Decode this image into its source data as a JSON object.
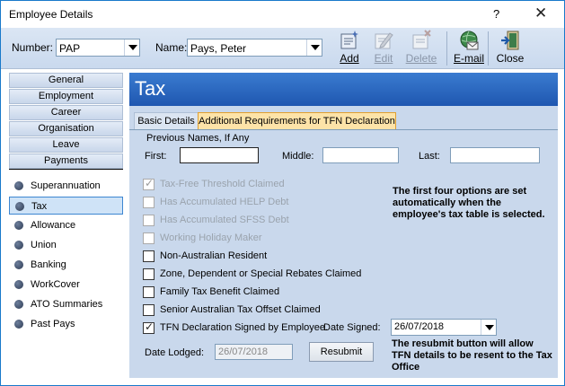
{
  "window": {
    "title": "Employee Details",
    "help_label": "?",
    "close_label": "✕"
  },
  "toolbar": {
    "number_label": "Number:",
    "number_value": "PAP",
    "name_label": "Name:",
    "name_value": "Pays, Peter",
    "buttons": [
      {
        "label": "Add",
        "enabled": true
      },
      {
        "label": "Edit",
        "enabled": false
      },
      {
        "label": "Delete",
        "enabled": false
      },
      {
        "label": "E-mail",
        "enabled": true
      },
      {
        "label": "Close",
        "enabled": true
      }
    ]
  },
  "nav": {
    "groups": [
      "General",
      "Employment",
      "Career",
      "Organisation",
      "Leave",
      "Payments"
    ],
    "items": [
      "Superannuation",
      "Tax",
      "Allowance",
      "Union",
      "Banking",
      "WorkCover",
      "ATO Summaries",
      "Past Pays"
    ],
    "selected": "Tax"
  },
  "panel": {
    "title": "Tax",
    "tabs": [
      {
        "label": "Basic Details",
        "active": false
      },
      {
        "label": "Additional Requirements for TFN Declaration",
        "active": true
      }
    ],
    "previous_names_label": "Previous Names, If Any",
    "first_label": "First:",
    "middle_label": "Middle:",
    "last_label": "Last:",
    "first_value": "",
    "middle_value": "",
    "last_value": "",
    "checkboxes": [
      {
        "label": "Tax-Free Threshold Claimed",
        "checked": true,
        "enabled": false
      },
      {
        "label": "Has Accumulated HELP Debt",
        "checked": false,
        "enabled": false
      },
      {
        "label": "Has Accumulated SFSS Debt",
        "checked": false,
        "enabled": false
      },
      {
        "label": "Working Holiday Maker",
        "checked": false,
        "enabled": false
      },
      {
        "label": "Non-Australian Resident",
        "checked": false,
        "enabled": true
      },
      {
        "label": "Zone, Dependent or Special Rebates Claimed",
        "checked": false,
        "enabled": true
      },
      {
        "label": "Family Tax Benefit Claimed",
        "checked": false,
        "enabled": true
      },
      {
        "label": "Senior Australian Tax Offset Claimed",
        "checked": false,
        "enabled": true
      },
      {
        "label": "TFN Declaration Signed by Employee.",
        "checked": true,
        "enabled": true
      }
    ],
    "note_auto": "The first four options are set automatically when the employee's tax table is selected.",
    "date_signed_label": "Date Signed:",
    "date_signed_value": "26/07/2018",
    "date_lodged_label": "Date Lodged:",
    "date_lodged_value": "26/07/2018",
    "resubmit_label": "Resubmit",
    "note_resubmit": "The resubmit button will allow TFN details to be resent to the Tax Office"
  }
}
